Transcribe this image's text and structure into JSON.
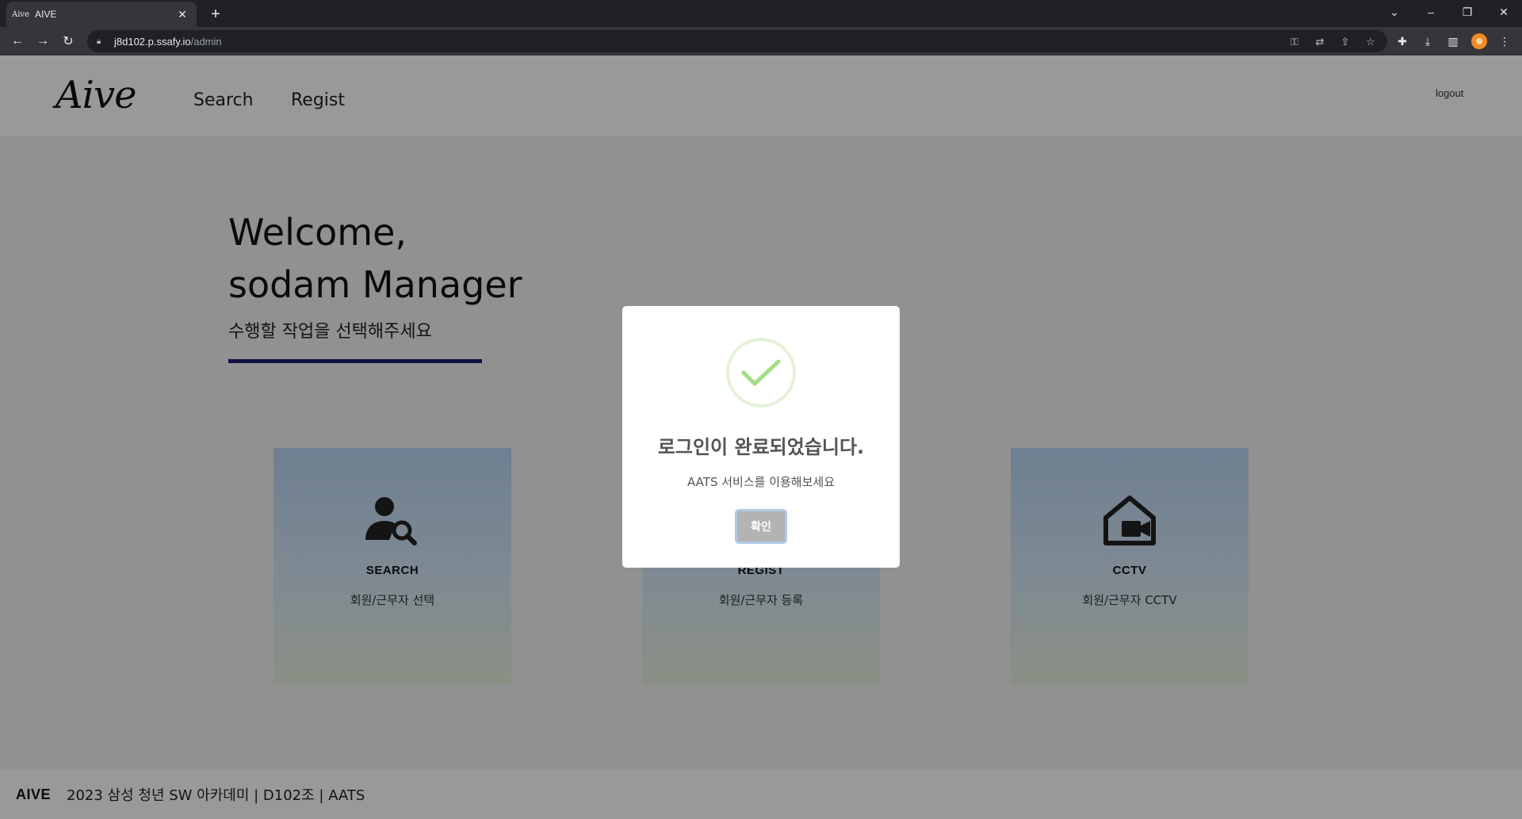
{
  "browser": {
    "tab_title": "AIVE",
    "tab_favicon_text": "Aive",
    "url_host": "j8d102.p.ssafy.io",
    "url_path": "/admin",
    "icons": {
      "back": "arrow-left-icon",
      "forward": "arrow-right-icon",
      "reload": "reload-icon",
      "lock": "lock-icon",
      "key": "key-icon",
      "translate": "translate-icon",
      "share": "share-icon",
      "bookmark": "star-icon",
      "extensions": "puzzle-icon",
      "downloads": "download-icon",
      "sidepanel": "sidepanel-icon",
      "menu": "kebab-menu-icon"
    }
  },
  "header": {
    "logo": "Aive",
    "nav": [
      {
        "label": "Search"
      },
      {
        "label": "Regist"
      }
    ],
    "logout": "logout"
  },
  "main": {
    "welcome_line1": "Welcome,",
    "welcome_line2": "sodam Manager",
    "subtitle": "수행할 작업을 선택해주세요",
    "accent_color": "#1a1a6e",
    "cards": [
      {
        "title": "SEARCH",
        "desc": "회원/근무자 선택",
        "icon": "user-search-icon"
      },
      {
        "title": "REGIST",
        "desc": "회원/근무자 등록",
        "icon": "user-add-icon"
      },
      {
        "title": "CCTV",
        "desc": "회원/근무자 CCTV",
        "icon": "home-camera-icon"
      }
    ]
  },
  "footer": {
    "brand": "AIVE",
    "text": "2023 삼성 청년 SW 아카데미 | D102조 | AATS"
  },
  "modal": {
    "icon": "check-success-icon",
    "success_color": "#a5dc86",
    "title": "로그인이 완료되었습니다.",
    "text": "AATS 서비스를 이용해보세요",
    "confirm": "확인"
  }
}
